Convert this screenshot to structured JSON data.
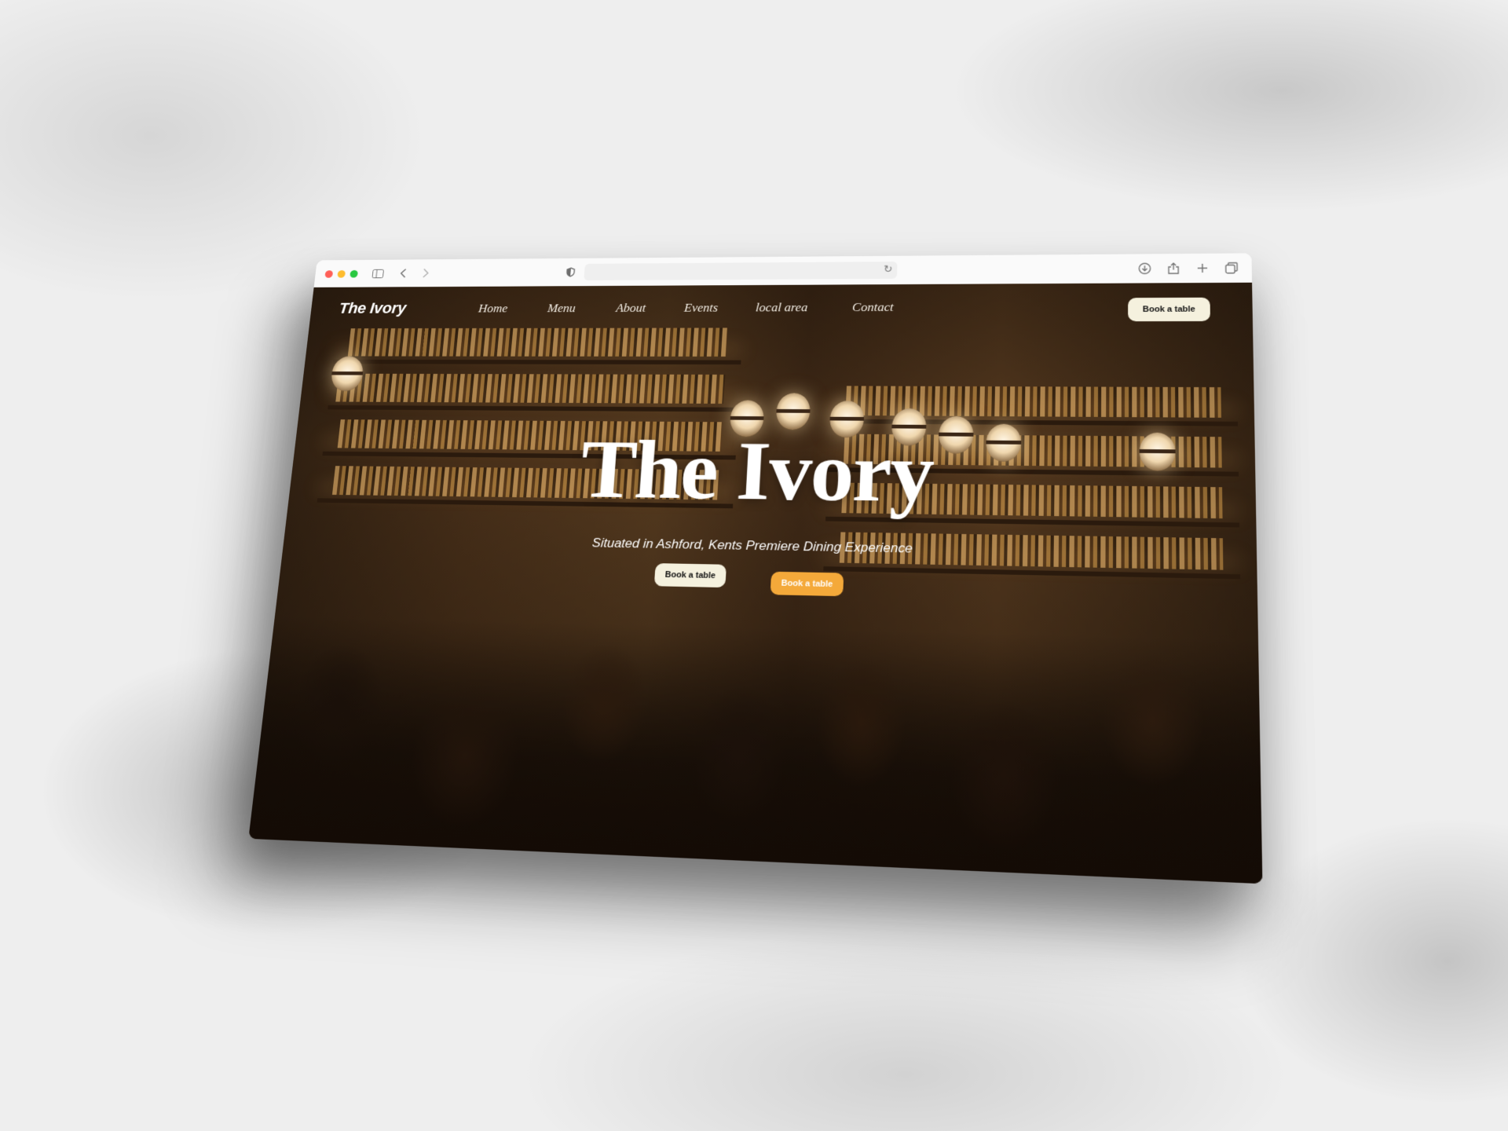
{
  "browser": {
    "toolbar_icons": [
      "sidebar-icon",
      "back-icon",
      "forward-icon",
      "shield-icon",
      "reload-icon",
      "download-icon",
      "share-icon",
      "new-tab-icon",
      "tabs-icon"
    ],
    "address_value": ""
  },
  "site": {
    "logo": "The Ivory",
    "nav": [
      "Home",
      "Menu",
      "About",
      "Events",
      "local area",
      "Contact"
    ],
    "nav_cta": "Book a table",
    "hero_title": "The Ivory",
    "hero_subtitle": "Situated in Ashford, Kents Premiere Dining Experience",
    "hero_button_primary": "Book a table",
    "hero_button_accent": "Book a table"
  },
  "colors": {
    "cta_light": "#f5f1de",
    "cta_accent": "#f4a93a",
    "traffic_red": "#ff5f57",
    "traffic_yellow": "#febc2e",
    "traffic_green": "#28c840"
  }
}
